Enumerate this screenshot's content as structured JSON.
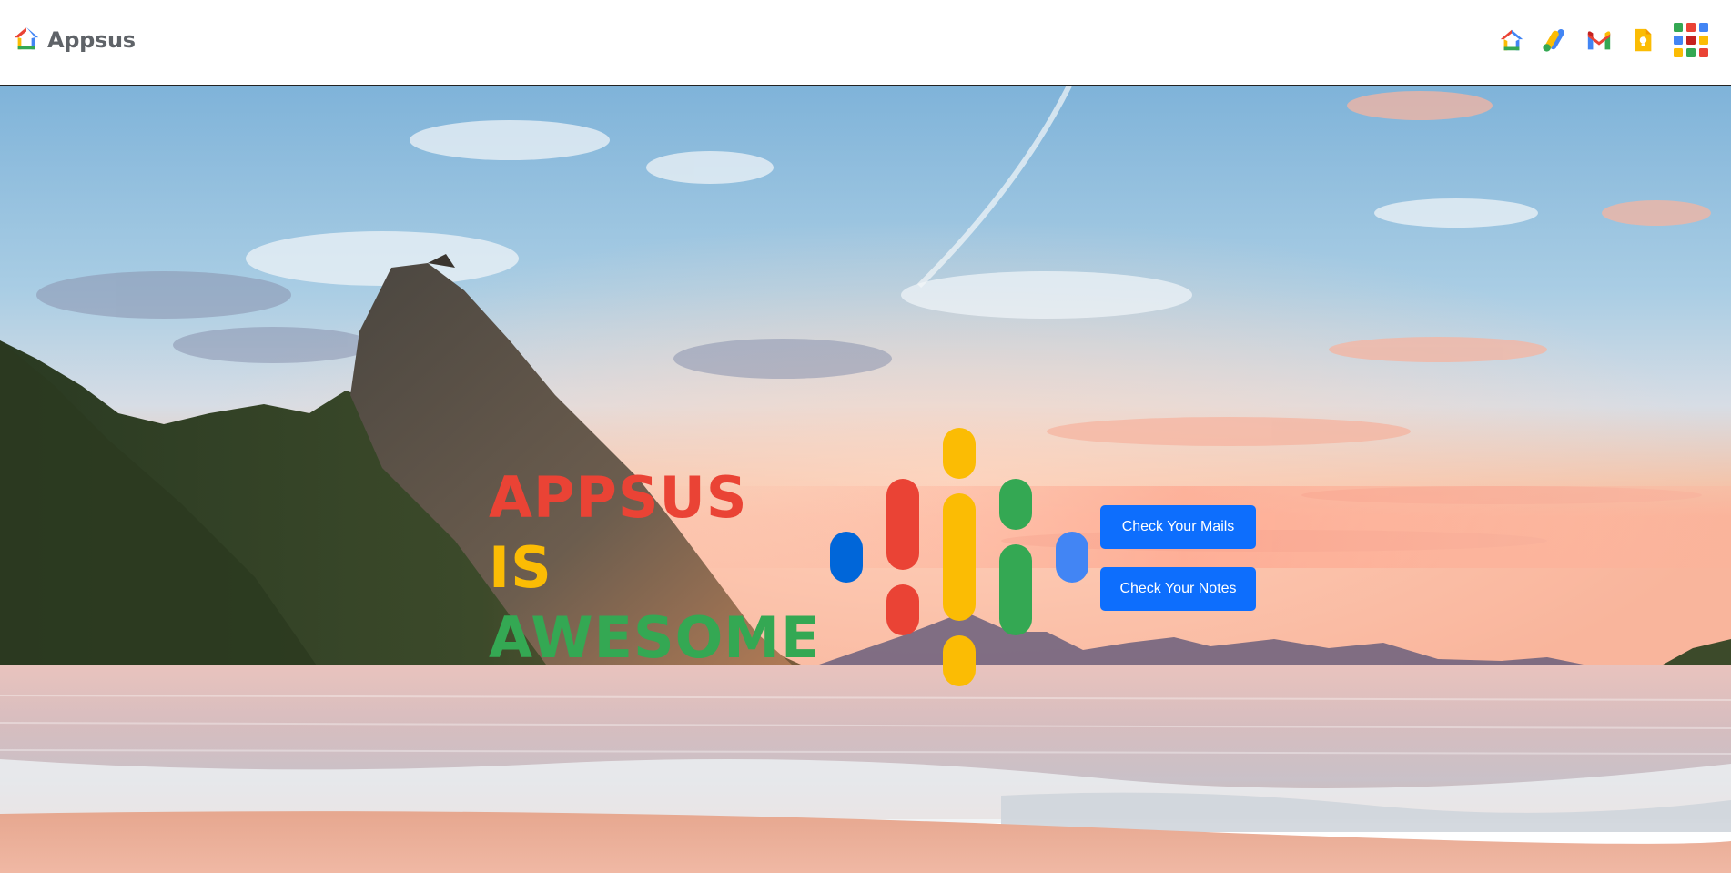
{
  "header": {
    "brand_name": "Appsus",
    "nav": [
      {
        "icon": "home-icon"
      },
      {
        "icon": "google-ads-icon"
      },
      {
        "icon": "gmail-icon"
      },
      {
        "icon": "keep-icon"
      },
      {
        "icon": "apps-grid-icon"
      }
    ]
  },
  "hero": {
    "background": "beach-sunset-mountain-photo",
    "tagline": [
      "APPSUS",
      "IS",
      "AWESOME"
    ],
    "logo": "google-podcasts-icon",
    "buttons": {
      "mails_label": "Check Your Mails",
      "notes_label": "Check Your Notes"
    }
  },
  "colors": {
    "red": "#ea4335",
    "yellow": "#fbbc04",
    "green": "#34a853",
    "blue": "#4285f4",
    "dark_blue": "#0066d9",
    "button": "#0d6efd"
  }
}
